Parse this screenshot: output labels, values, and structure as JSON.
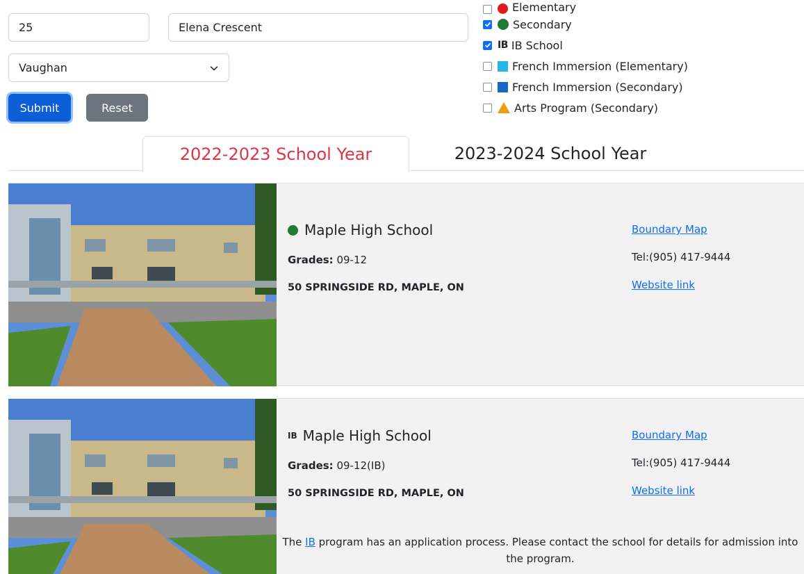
{
  "form": {
    "house_number": "25",
    "street_name": "Elena Crescent",
    "city": "Vaughan",
    "submit_label": "Submit",
    "reset_label": "Reset"
  },
  "filters": [
    {
      "label": "Elementary",
      "checked": false,
      "marker": "red-circle"
    },
    {
      "label": "Secondary",
      "checked": true,
      "marker": "green-circle"
    },
    {
      "label": "IB School",
      "checked": true,
      "marker": "IB"
    },
    {
      "label": "French Immersion (Elementary)",
      "checked": false,
      "marker": "cyan-square"
    },
    {
      "label": "French Immersion (Secondary)",
      "checked": false,
      "marker": "blue-square"
    },
    {
      "label": "Arts Program (Secondary)",
      "checked": false,
      "marker": "orange-triangle"
    }
  ],
  "ib_marker_text": "IB",
  "tabs": [
    {
      "label": "2022-2023 School Year",
      "active": true
    },
    {
      "label": "2023-2024 School Year",
      "active": false
    }
  ],
  "schools": [
    {
      "name": "Maple High School",
      "grades_label": "Grades:",
      "grades": "09-12",
      "address": "50 SPRINGSIDE RD, MAPLE, ON",
      "boundary_link": "Boundary Map",
      "tel": "Tel:(905) 417-9444",
      "website_link": "Website link"
    },
    {
      "name": "Maple High School",
      "grades_label": "Grades:",
      "grades": "09-12(IB)",
      "address": "50 SPRINGSIDE RD, MAPLE, ON",
      "boundary_link": "Boundary Map",
      "tel": "Tel:(905) 417-9444",
      "website_link": "Website link",
      "note_before": "The ",
      "note_link": "IB",
      "note_after": " program has an application process. Please contact the school for details for admission into the program."
    }
  ],
  "colors": {
    "primary": "#0d6efd",
    "active_tab": "#dc3545",
    "secondary_marker": "#1e7a35"
  }
}
